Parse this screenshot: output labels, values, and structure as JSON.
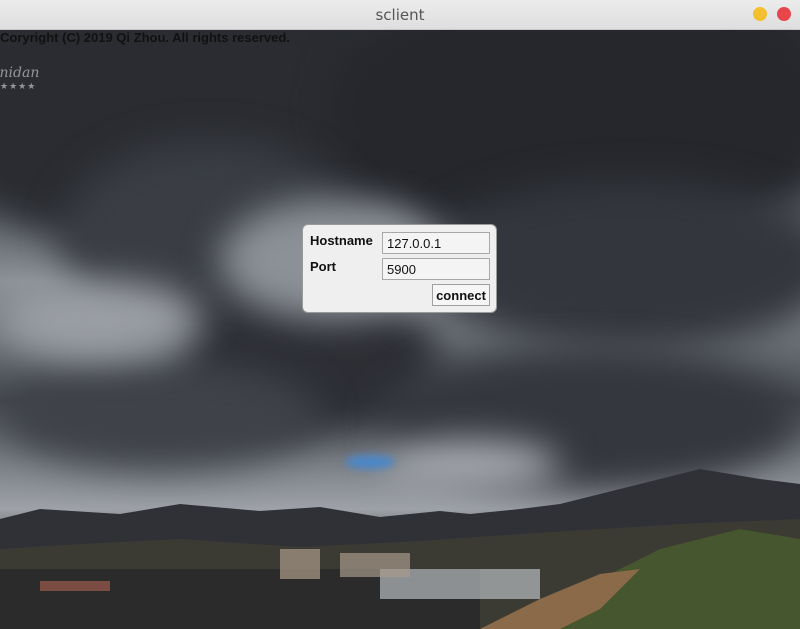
{
  "window": {
    "title": "sclient",
    "minimize_color": "#f4bf2e",
    "close_color": "#e8464a"
  },
  "copyright": "Coryright (C) 2019 Qi Zhou. All rights reserved.",
  "watermark": {
    "text": "Inidan",
    "stars": "★★★★"
  },
  "connect_dialog": {
    "hostname_label": "Hostname",
    "hostname_value": "127.0.0.1",
    "port_label": "Port",
    "port_value": "5900",
    "connect_label": "connect"
  }
}
